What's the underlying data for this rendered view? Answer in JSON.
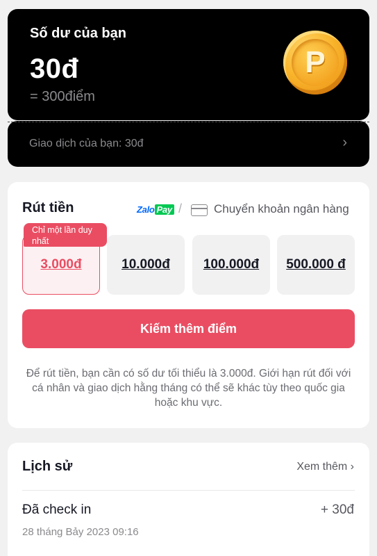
{
  "balance": {
    "title": "Số dư của bạn",
    "amount": "30đ",
    "points": "= 300điểm",
    "coin_letter": "P",
    "coin_icon": "coin-p-icon"
  },
  "transactions": {
    "label": "Giao dịch của bạn: 30đ",
    "chevron": "›"
  },
  "withdraw": {
    "title": "Rút tiền",
    "zalopay_text": "Zalo",
    "zalopay_pay": "Pay",
    "separator": "/",
    "bank_label": "Chuyển khoản ngân hàng",
    "badge": "Chỉ một lần duy nhất",
    "amounts": [
      "3.000đ",
      "10.000đ",
      "100.000đ",
      "500.000 đ"
    ],
    "selected_index": 0,
    "cta": "Kiếm thêm điểm",
    "note": "Để rút tiền, bạn cần có số dư tối thiểu là 3.000đ. Giới hạn rút đối với cá nhân và giao dịch hằng tháng có thể sẽ khác tùy theo quốc gia hoặc khu vực."
  },
  "history": {
    "title": "Lịch sử",
    "more": "Xem thêm ›",
    "items": [
      {
        "label": "Đã check in",
        "value": "+ 30đ",
        "date": "28 tháng Bảy 2023 09:16"
      }
    ]
  },
  "colors": {
    "accent": "#ea4d62",
    "dark_card": "#000000",
    "background": "#f1f1f2",
    "coin": "#f4a623"
  }
}
